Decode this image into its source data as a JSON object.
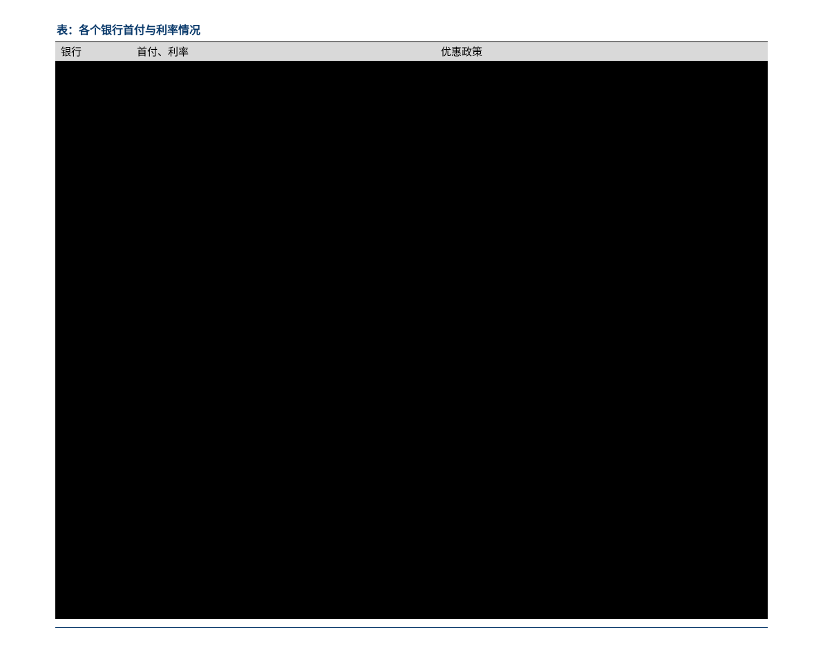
{
  "title": "表：各个银行首付与利率情况",
  "columns": {
    "bank": "银行",
    "rate": "首付、利率",
    "policy": "优惠政策"
  },
  "colors": {
    "title_color": "#0a3a6b",
    "header_bg": "#d9d9d9",
    "border": "#000000"
  }
}
